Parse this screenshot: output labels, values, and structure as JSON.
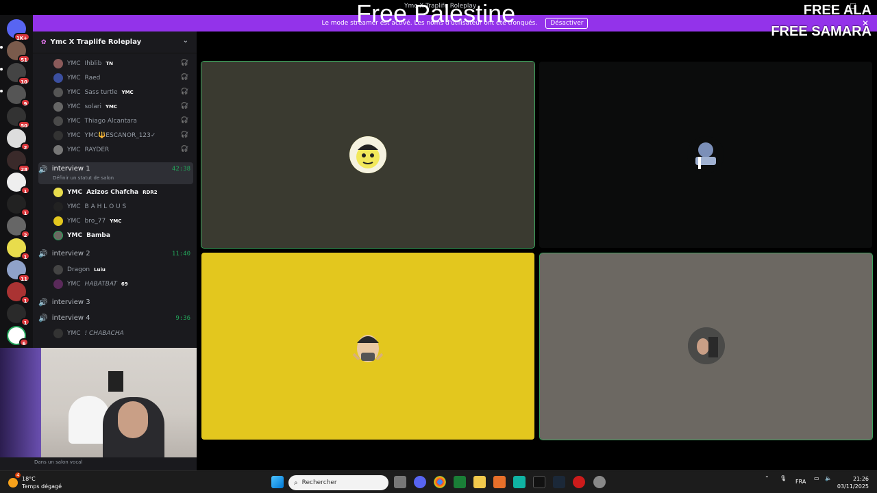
{
  "window": {
    "title": "Ymc X Traplife Roleplay"
  },
  "overlay": {
    "center_text": "Free Palestine",
    "right_line1": "FREE ALA",
    "right_line2": "FREE SAMARA"
  },
  "banner": {
    "message": "Le mode streamer est activé. Les noms d'utilisateur ont été tronqués.",
    "button": "Désactiver"
  },
  "rail_badges": [
    "1K+",
    "51",
    "10",
    "9",
    "50",
    "2",
    "28",
    "1",
    "1",
    "2",
    "1",
    "11",
    "1",
    "1",
    "6"
  ],
  "server": {
    "name": "Ymc X Traplife Roleplay"
  },
  "top_members": [
    {
      "prefix": "YMC",
      "name": "Ihblib",
      "tag": "TN"
    },
    {
      "prefix": "YMC",
      "name": "Raed",
      "tag": ""
    },
    {
      "prefix": "YMC",
      "name": "Sass turtle",
      "tag": "YMC"
    },
    {
      "prefix": "YMC",
      "name": "solari",
      "tag": "YMC"
    },
    {
      "prefix": "YMC",
      "name": "Thiago Alcantara",
      "tag": ""
    },
    {
      "prefix": "YMC",
      "name": "YMC🔱ESCANOR_123✓",
      "tag": ""
    },
    {
      "prefix": "YMC",
      "name": "RAYDER",
      "tag": ""
    }
  ],
  "channels": [
    {
      "name": "interview 1",
      "time": "42:38",
      "status": "Définir un statut de salon"
    },
    {
      "name": "interview 2",
      "time": "11:40"
    },
    {
      "name": "interview 3",
      "time": ""
    },
    {
      "name": "interview 4",
      "time": "9:36"
    }
  ],
  "interview1_members": [
    {
      "prefix": "YMC",
      "name": "Azizos Chafcha",
      "tag": "RDR2"
    },
    {
      "prefix": "YMC",
      "name": "B A H L O U S",
      "tag": ""
    },
    {
      "prefix": "YMC",
      "name": "bro_77",
      "tag": "YMC"
    },
    {
      "prefix": "YMC",
      "name": "Bamba",
      "tag": ""
    }
  ],
  "interview2_members": [
    {
      "prefix": "",
      "name": "Dragon",
      "tag": "Luiu"
    },
    {
      "prefix": "YMC",
      "name": "HABATBAT",
      "tag": "69"
    }
  ],
  "interview4_members": [
    {
      "prefix": "YMC",
      "name": "! CHABACHA",
      "tag": ""
    }
  ],
  "voice_status": "Dans un salon vocal",
  "video_tiles": [
    {
      "color": "#3a3a30",
      "speaking": true
    },
    {
      "color": "#0b0c0c",
      "speaking": false
    },
    {
      "color": "#e3c71e",
      "speaking": false
    },
    {
      "color": "#6c6862",
      "speaking": true
    }
  ],
  "taskbar": {
    "weather_temp": "18°C",
    "weather_desc": "Temps dégagé",
    "search_placeholder": "Rechercher",
    "lang": "FRA",
    "time": "21:26",
    "date": "03/11/2025",
    "weather_badge": "4"
  }
}
